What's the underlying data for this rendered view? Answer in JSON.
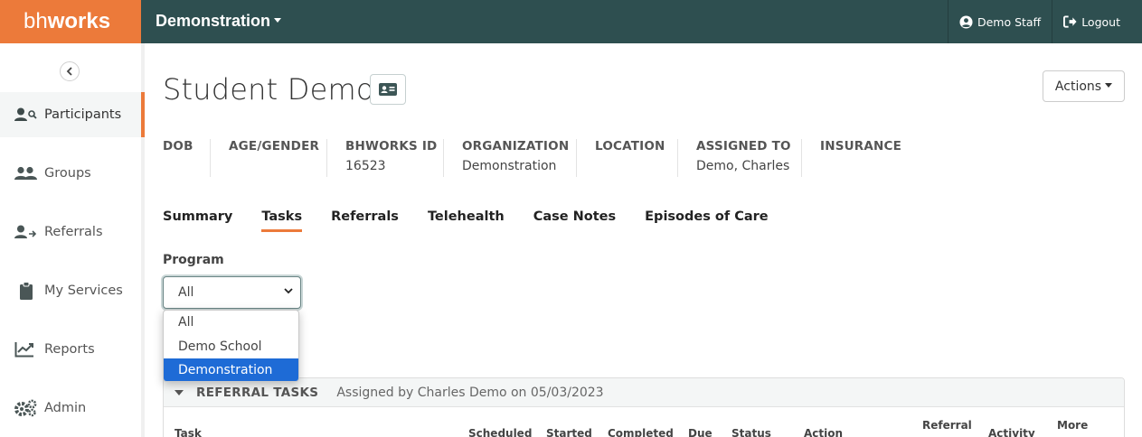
{
  "brand": {
    "light": "bh",
    "bold": "works"
  },
  "header": {
    "org": "Demonstration",
    "user": "Demo Staff",
    "logout": "Logout"
  },
  "sidebar": {
    "items": [
      {
        "label": "Participants",
        "icon": "participants-search-icon",
        "active": true
      },
      {
        "label": "Groups",
        "icon": "groups-icon"
      },
      {
        "label": "Referrals",
        "icon": "referrals-icon"
      },
      {
        "label": "My Services",
        "icon": "clipboard-icon"
      },
      {
        "label": "Reports",
        "icon": "chart-line-icon"
      },
      {
        "label": "Admin",
        "icon": "gears-icon"
      }
    ]
  },
  "page": {
    "title": "Student Demo",
    "actions": "Actions"
  },
  "info": [
    {
      "label": "DOB",
      "value": ""
    },
    {
      "label": "AGE/GENDER",
      "value": ""
    },
    {
      "label": "BHWORKS ID",
      "value": "16523"
    },
    {
      "label": "ORGANIZATION",
      "value": "Demonstration"
    },
    {
      "label": "LOCATION",
      "value": ""
    },
    {
      "label": "ASSIGNED TO",
      "value": "Demo, Charles"
    },
    {
      "label": "INSURANCE",
      "value": ""
    }
  ],
  "tabs": [
    {
      "label": "Summary"
    },
    {
      "label": "Tasks",
      "active": true
    },
    {
      "label": "Referrals"
    },
    {
      "label": "Telehealth"
    },
    {
      "label": "Case Notes"
    },
    {
      "label": "Episodes of Care"
    }
  ],
  "program": {
    "label": "Program",
    "selected": "All",
    "options": [
      "All",
      "Demo School",
      "Demonstration"
    ],
    "highlighted": "Demonstration"
  },
  "referral_tasks": {
    "title": "REFERRAL TASKS",
    "subtitle": "Assigned by Charles Demo on 05/03/2023",
    "columns": {
      "task": "Task",
      "scheduled": "Scheduled",
      "started": "Started",
      "completed": "Completed",
      "due": "Due",
      "status": "Status",
      "action": "Action",
      "referral": "Referral",
      "activity": "Activity",
      "more": "More"
    }
  },
  "colors": {
    "accent": "#ec7a3a",
    "topbar": "#2e4f50",
    "selection": "#1e6bd6"
  }
}
